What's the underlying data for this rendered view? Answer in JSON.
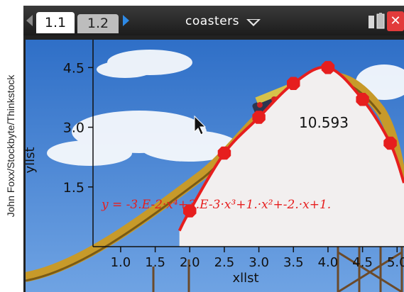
{
  "credit_text": "John Foxx/Stockbyte/Thinkstock",
  "tabs": [
    {
      "label": "1.1",
      "active": true
    },
    {
      "label": "1.2",
      "active": false
    }
  ],
  "document_title": "coasters",
  "close_label": "✕",
  "graph": {
    "yaxis_label": "yllst",
    "xaxis_label": "xllst",
    "x_ticks": [
      "1.0",
      "1.5",
      "2.0",
      "2.5",
      "3.0",
      "3.5",
      "4.0",
      "4.5",
      "5.0"
    ],
    "y_ticks": [
      "1.5",
      "3.0",
      "4.5"
    ],
    "max_readout": "10.593",
    "equation": "y = -3.E-2·x⁴+3.E-3·x³+1.·x²+-2.·x+1.",
    "curve_color": "#e61e1e"
  },
  "chart_data": {
    "type": "scatter",
    "xlabel": "xllst",
    "ylabel": "yllst",
    "xlim": [
      0.6,
      5.1
    ],
    "ylim": [
      0,
      5.2
    ],
    "points": [
      {
        "x": 2.0,
        "y": 0.9
      },
      {
        "x": 2.5,
        "y": 2.35
      },
      {
        "x": 3.0,
        "y": 3.25
      },
      {
        "x": 3.5,
        "y": 4.1
      },
      {
        "x": 4.0,
        "y": 4.5
      },
      {
        "x": 4.5,
        "y": 3.7
      },
      {
        "x": 4.9,
        "y": 2.6
      }
    ],
    "annotation": "10.593",
    "fit_equation": "y = -3.E-2·x⁴+3.E-3·x³+1.·x²+-2.·x+1."
  }
}
